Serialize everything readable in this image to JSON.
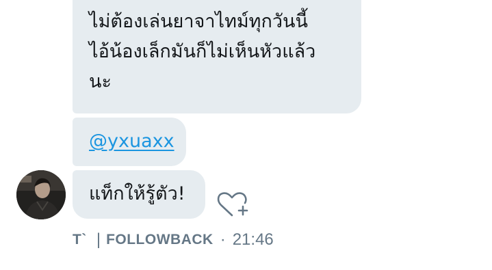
{
  "messages": [
    {
      "lines": [
        "ไม่ต้องเล่นยาจาไทม์ทุกวันนี้",
        "ไอ้น้องเล็กมันก็ไม่เห็นหัวแล้ว",
        "นะ"
      ]
    },
    {
      "mention": "@yxuaxx"
    },
    {
      "text": "แท็กให้รู้ตัว!"
    }
  ],
  "sender": {
    "name": "T`",
    "separator": "|",
    "handle": "FOLLOWBACK",
    "dot": "·",
    "time": "21:46",
    "avatar": "avatar-photo"
  },
  "icons": {
    "like": "heart-plus-icon"
  },
  "colors": {
    "bubble": "#e6ecf0",
    "text": "#14171a",
    "link": "#1b95e0",
    "meta": "#657786",
    "icon": "#657786"
  }
}
